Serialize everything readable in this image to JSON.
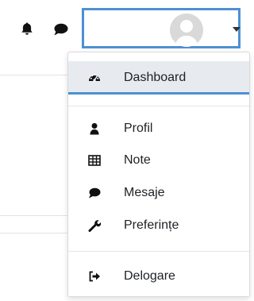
{
  "navbar": {
    "notifications_icon": "bell-icon",
    "messages_icon": "comment-icon",
    "user_menu": {
      "avatar_icon": "user-avatar-icon",
      "caret_icon": "caret-down-icon"
    }
  },
  "user_menu": {
    "items": [
      {
        "label": "Dashboard",
        "icon": "dashboard-icon",
        "active": true
      },
      {
        "label": "Profil",
        "icon": "user-icon"
      },
      {
        "label": "Note",
        "icon": "table-icon"
      },
      {
        "label": "Mesaje",
        "icon": "comment-icon"
      },
      {
        "label": "Preferințe",
        "icon": "wrench-icon"
      },
      {
        "label": "Delogare",
        "icon": "sign-out-icon"
      }
    ]
  },
  "colors": {
    "accent": "#4d90d3",
    "active_bg": "#e7ebf0",
    "text": "#1d2125"
  }
}
